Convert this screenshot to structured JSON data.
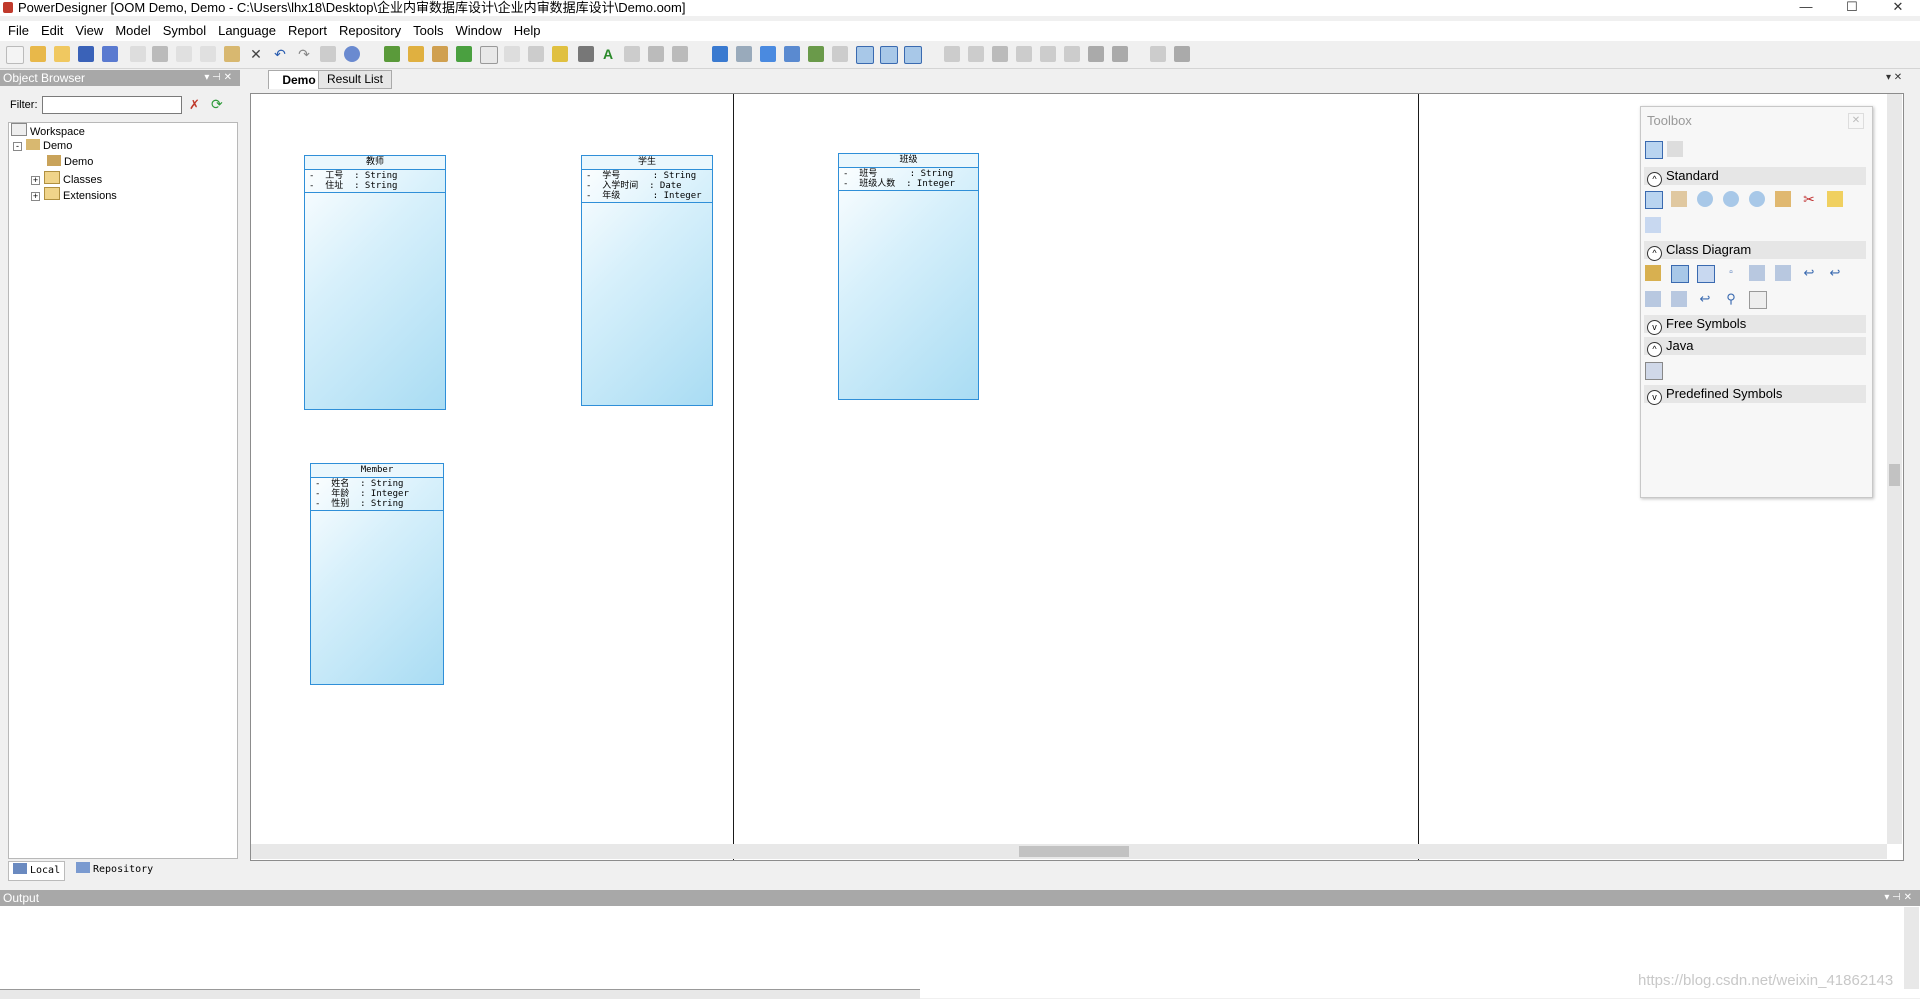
{
  "window": {
    "title": "PowerDesigner [OOM Demo, Demo - C:\\Users\\lhx18\\Desktop\\企业内审数据库设计\\企业内审数据库设计\\Demo.oom]"
  },
  "menu": [
    "File",
    "Edit",
    "View",
    "Model",
    "Symbol",
    "Language",
    "Report",
    "Repository",
    "Tools",
    "Window",
    "Help"
  ],
  "object_browser": {
    "title": "Object Browser",
    "filter_label": "Filter:",
    "filter_value": "",
    "tree": [
      "Workspace",
      "Demo",
      "Demo",
      "Classes",
      "Extensions"
    ],
    "tabs": [
      "Local",
      "Repository"
    ]
  },
  "tabs": {
    "active": "Demo",
    "other": "Result List"
  },
  "classes": [
    {
      "name": "教师",
      "attributes": [
        "-  工号  : String",
        "-  住址  : String"
      ]
    },
    {
      "name": "学生",
      "attributes": [
        "-  学号      : String",
        "-  入学时间  : Date",
        "-  年级      : Integer"
      ]
    },
    {
      "name": "班级",
      "attributes": [
        "-  班号      : String",
        "-  班级人数  : Integer"
      ]
    },
    {
      "name": "Member",
      "attributes": [
        "-  姓名  : String",
        "-  年龄  : Integer",
        "-  性别  : String"
      ]
    }
  ],
  "toolbox": {
    "title": "Toolbox",
    "sections": [
      "Standard",
      "Class Diagram",
      "Free Symbols",
      "Java",
      "Predefined Symbols"
    ]
  },
  "output": {
    "title": "Output"
  },
  "watermark": "https://blog.csdn.net/weixin_41862143",
  "colors": {
    "class_border": "#2f8fd8",
    "panel_header": "#a8a8a8"
  }
}
